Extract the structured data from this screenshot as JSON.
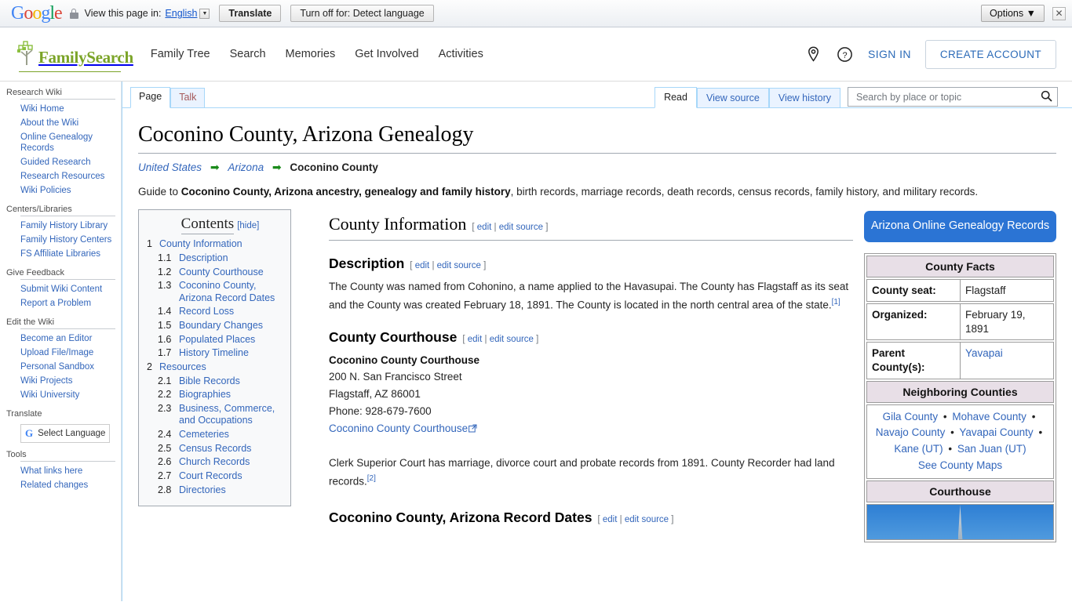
{
  "translate_bar": {
    "logo_letters": [
      "G",
      "o",
      "o",
      "g",
      "l",
      "e"
    ],
    "lock_icon": "lock-icon",
    "view_label": "View this page in:",
    "language": "English",
    "translate_button": "Translate",
    "turn_off_button": "Turn off for: Detect language",
    "options_button": "Options",
    "options_caret": "▼",
    "close_icon": "✕"
  },
  "header": {
    "brand": "FamilySearch",
    "nav": [
      {
        "label": "Family Tree"
      },
      {
        "label": "Search"
      },
      {
        "label": "Memories"
      },
      {
        "label": "Get Involved"
      },
      {
        "label": "Activities"
      }
    ],
    "location_icon": "location-pin-icon",
    "help_icon": "help-circle-icon",
    "sign_in": "SIGN IN",
    "create_account": "CREATE ACCOUNT"
  },
  "sidebar": {
    "portals": [
      {
        "heading": "Research Wiki",
        "links": [
          "Wiki Home",
          "About the Wiki",
          "Online Genealogy Records",
          "Guided Research",
          "Research Resources",
          "Wiki Policies"
        ]
      },
      {
        "heading": "Centers/Libraries",
        "links": [
          "Family History Library",
          "Family History Centers",
          "FS Affiliate Libraries"
        ]
      },
      {
        "heading": "Give Feedback",
        "links": [
          "Submit Wiki Content",
          "Report a Problem"
        ]
      },
      {
        "heading": "Edit the Wiki",
        "links": [
          "Become an Editor",
          "Upload File/Image",
          "Personal Sandbox",
          "Wiki Projects",
          "Wiki University"
        ]
      }
    ],
    "translate": {
      "heading": "Translate",
      "select_label": "Select Language",
      "google_mark": "G"
    },
    "tools": {
      "heading": "Tools",
      "links": [
        "What links here",
        "Related changes"
      ]
    }
  },
  "tabs": {
    "left": [
      {
        "label": "Page",
        "active": true
      },
      {
        "label": "Talk",
        "active": false
      }
    ],
    "right": [
      {
        "label": "Read",
        "active": true
      },
      {
        "label": "View source",
        "active": false
      },
      {
        "label": "View history",
        "active": false
      }
    ]
  },
  "search": {
    "placeholder": "Search by place or topic",
    "value": "",
    "icon": "search-icon"
  },
  "article": {
    "title": "Coconino County, Arizona Genealogy",
    "breadcrumb": {
      "links": [
        "United States",
        "Arizona"
      ],
      "arrow": "➡",
      "current": "Coconino County"
    },
    "lede_prefix": "Guide to ",
    "lede_bold": "Coconino County, Arizona ancestry, genealogy and family history",
    "lede_suffix": ", birth records, marriage records, death records, census records, family history, and military records."
  },
  "toc": {
    "title": "Contents",
    "hide_label": "[hide]",
    "items": [
      {
        "num": "1",
        "label": "County Information",
        "level": 1
      },
      {
        "num": "1.1",
        "label": "Description",
        "level": 2
      },
      {
        "num": "1.2",
        "label": "County Courthouse",
        "level": 2
      },
      {
        "num": "1.3",
        "label": "Coconino County, Arizona Record Dates",
        "level": 2
      },
      {
        "num": "1.4",
        "label": "Record Loss",
        "level": 2
      },
      {
        "num": "1.5",
        "label": "Boundary Changes",
        "level": 2
      },
      {
        "num": "1.6",
        "label": "Populated Places",
        "level": 2
      },
      {
        "num": "1.7",
        "label": "History Timeline",
        "level": 2
      },
      {
        "num": "2",
        "label": "Resources",
        "level": 1
      },
      {
        "num": "2.1",
        "label": "Bible Records",
        "level": 2
      },
      {
        "num": "2.2",
        "label": "Biographies",
        "level": 2
      },
      {
        "num": "2.3",
        "label": "Business, Commerce, and Occupations",
        "level": 2
      },
      {
        "num": "2.4",
        "label": "Cemeteries",
        "level": 2
      },
      {
        "num": "2.5",
        "label": "Census Records",
        "level": 2
      },
      {
        "num": "2.6",
        "label": "Church Records",
        "level": 2
      },
      {
        "num": "2.7",
        "label": "Court Records",
        "level": 2
      },
      {
        "num": "2.8",
        "label": "Directories",
        "level": 2
      }
    ]
  },
  "main": {
    "edit": "edit",
    "edit_source": "edit source",
    "bracket_open": "[",
    "bracket_close": "]",
    "separator": "|",
    "h2_county_information": "County Information",
    "h3_description": "Description",
    "description_text": "The County was named from Cohonino, a name applied to the Havasupai. The County has Flagstaff as its seat and the County was created February 18, 1891. The County is located in the north central area of the state.",
    "description_ref": "[1]",
    "h3_county_courthouse": "County Courthouse",
    "courthouse_name": "Coconino County Courthouse",
    "courthouse_street": "200 N. San Francisco Street",
    "courthouse_city": "Flagstaff, AZ 86001",
    "courthouse_phone": "Phone: 928-679-7600",
    "courthouse_link": "Coconino County Courthouse",
    "clerk_text": "Clerk Superior Court has marriage, divorce court and probate records from 1891. County Recorder had land records.",
    "clerk_ref": "[2]",
    "h3_record_dates": "Coconino County, Arizona Record Dates"
  },
  "rail": {
    "az_button": "Arizona Online Genealogy Records",
    "county_facts": {
      "heading": "County Facts",
      "rows": [
        {
          "label": "County seat:",
          "value": "Flagstaff",
          "link": false
        },
        {
          "label": "Organized:",
          "value": "February 19, 1891",
          "link": false
        },
        {
          "label": "Parent County(s):",
          "value": "Yavapai",
          "link": true
        }
      ]
    },
    "neighboring": {
      "heading": "Neighboring Counties",
      "counties": [
        "Gila County",
        "Mohave County",
        "Navajo County",
        "Yavapai County",
        "Kane (UT)",
        "San Juan (UT)"
      ],
      "bullet": "•",
      "see_maps": "See County Maps"
    },
    "courthouse_heading": "Courthouse"
  },
  "colors": {
    "accent_blue": "#2b74d4",
    "link_blue": "#3366bb",
    "brand_green": "#7ba428",
    "infobox_header": "#e8dfe7"
  }
}
